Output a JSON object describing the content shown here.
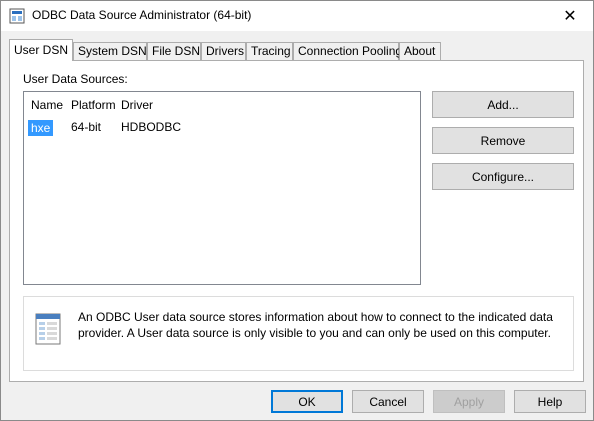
{
  "window": {
    "title": "ODBC Data Source Administrator (64-bit)",
    "close": "✕"
  },
  "tabs": [
    {
      "label": "User DSN"
    },
    {
      "label": "System DSN"
    },
    {
      "label": "File DSN"
    },
    {
      "label": "Drivers"
    },
    {
      "label": "Tracing"
    },
    {
      "label": "Connection Pooling"
    },
    {
      "label": "About"
    }
  ],
  "user_dsn": {
    "section_label": "User Data Sources:",
    "columns": [
      "Name",
      "Platform",
      "Driver"
    ],
    "rows": [
      {
        "name": "hxe",
        "platform": "64-bit",
        "driver": "HDBODBC"
      }
    ],
    "buttons": {
      "add": "Add...",
      "remove": "Remove",
      "configure": "Configure..."
    },
    "info": "An ODBC User data source stores information about how to connect to the indicated data provider.   A User data source is only visible to you and can only be used on this computer."
  },
  "footer": {
    "ok": "OK",
    "cancel": "Cancel",
    "apply": "Apply",
    "help": "Help"
  }
}
